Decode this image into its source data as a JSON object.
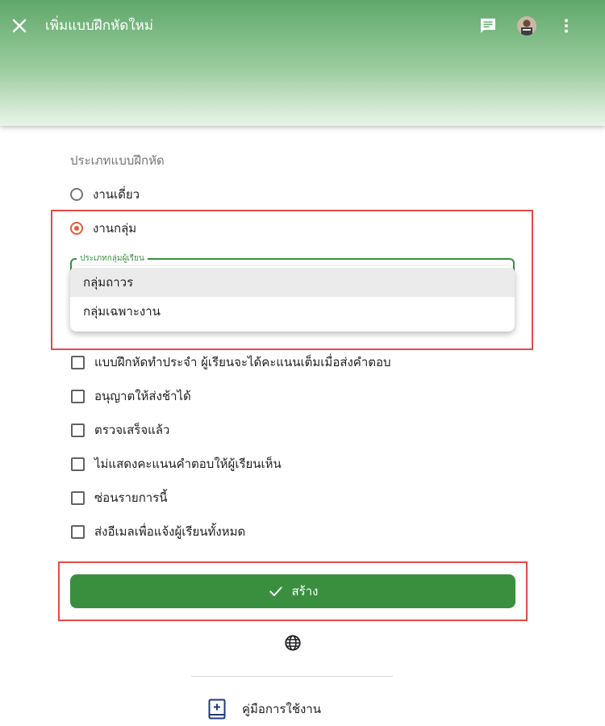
{
  "header": {
    "title": "เพิ่มแบบฝึกหัดใหม่"
  },
  "form": {
    "section_label": "ประเภทแบบฝึกหัด",
    "radios": [
      {
        "label": "งานเดี่ยว",
        "checked": false
      },
      {
        "label": "งานกลุ่ม",
        "checked": true
      }
    ],
    "group_type": {
      "label": "ประเภทกลุ่มผู้เรียน",
      "options": [
        "กลุ่มถาวร",
        "กลุ่มเฉพาะงาน"
      ],
      "highlighted_option": "กลุ่มถาวร"
    },
    "checkboxes": [
      "แบบฝึกหัดทำประจำ ผู้เรียนจะได้คะแนนเต็มเมื่อส่งคำตอบ",
      "อนุญาตให้ส่งช้าได้",
      "ตรวจเสร็จแล้ว",
      "ไม่แสดงคะแนนคำตอบให้ผู้เรียนเห็น",
      "ซ่อนรายการนี้",
      "ส่งอีเมลเพื่อแจ้งผู้เรียนทั้งหมด"
    ],
    "create_label": "สร้าง"
  },
  "footer": {
    "manual_label": "คู่มือการใช้งาน"
  },
  "icons": [
    "close-icon",
    "chat-icon",
    "avatar",
    "more-vert-icon",
    "check-icon",
    "globe-icon",
    "book-plus-icon"
  ],
  "colors": {
    "primary_green": "#3a8f3f",
    "radio_accent": "#e25c3a",
    "highlight_red": "#e24a4a"
  }
}
